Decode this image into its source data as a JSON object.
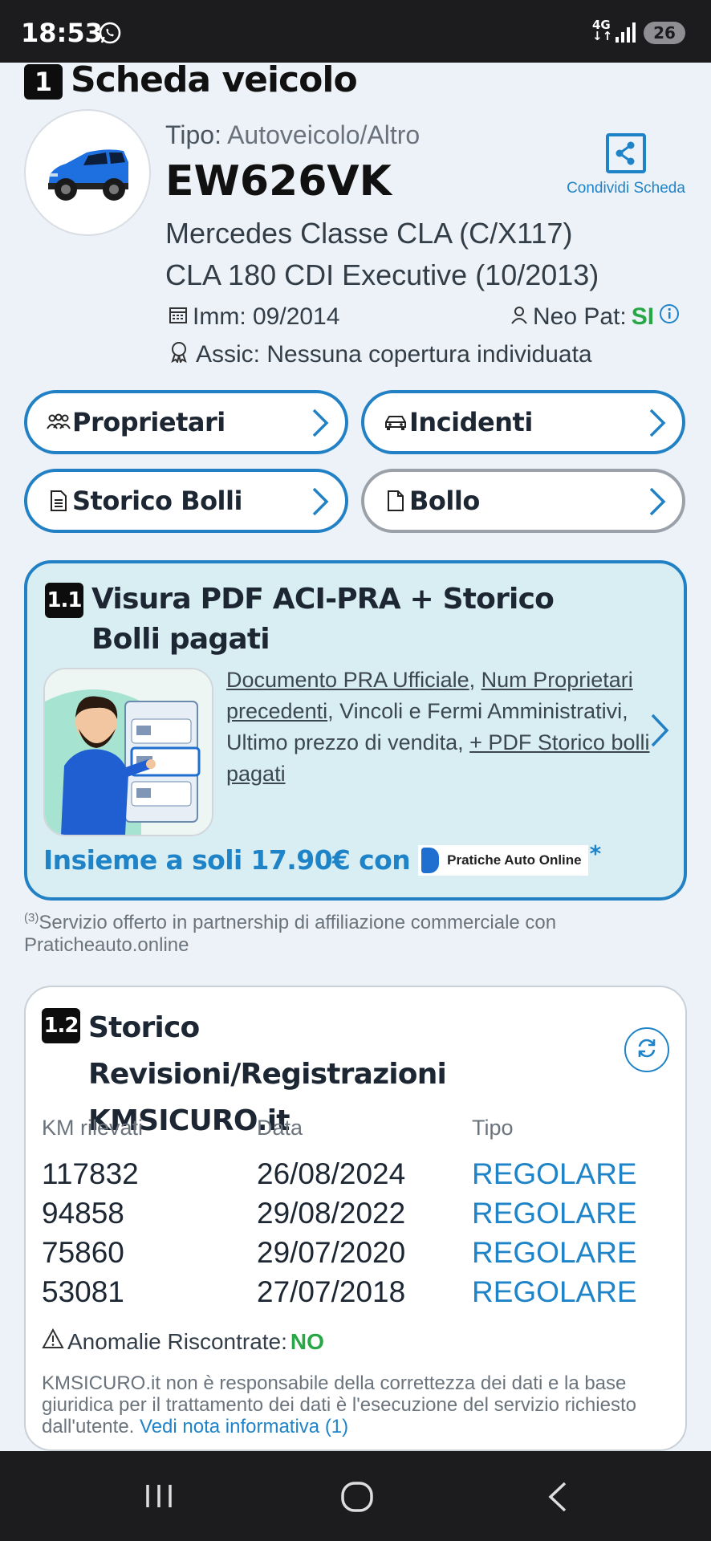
{
  "status_bar": {
    "time": "18:53",
    "network": "4G",
    "battery": "26"
  },
  "vehicle": {
    "section_number": "1",
    "section_title": "Scheda veicolo",
    "tipo_label": "Tipo:",
    "tipo_value": "Autoveicolo/Altro",
    "plate": "EW626VK",
    "share_label": "Condividi Scheda",
    "model_line1": "Mercedes Classe CLA (C/X117)",
    "model_line2": "CLA 180 CDI Executive (10/2013)",
    "imm": "Imm: 09/2014",
    "neo_pat_label": "Neo Pat:",
    "neo_pat_value": "SI",
    "assic": "Assic: Nessuna copertura individuata"
  },
  "buttons": {
    "proprietari": "Proprietari",
    "incidenti": "Incidenti",
    "storico_bolli": "Storico Bolli",
    "bollo": "Bollo"
  },
  "visura": {
    "number": "1.1",
    "title": "Visura PDF ACI-PRA + Storico Bolli pagati",
    "link1": "Documento PRA Ufficiale",
    "link2": "Num Proprietari precedenti",
    "text1": ", Vincoli e Fermi Amministrativi, Ultimo prezzo di vendita, ",
    "link3": "+ PDF Storico bolli pagati",
    "price_text": "Insieme a soli 17.90€ con",
    "partner_logo_text": "Pratiche Auto Online",
    "asterisk": "*"
  },
  "partner_note": {
    "sup": "(3)",
    "text": "Servizio offerto in partnership di affiliazione commerciale con Praticheauto.online"
  },
  "kmsicuro": {
    "number": "1.2",
    "title": "Storico Revisioni/Registrazioni KMSICURO.it",
    "columns": [
      "KM rilevati",
      "Data",
      "Tipo"
    ],
    "rows": [
      {
        "km": "117832",
        "data": "26/08/2024",
        "tipo": "REGOLARE"
      },
      {
        "km": "94858",
        "data": "29/08/2022",
        "tipo": "REGOLARE"
      },
      {
        "km": "75860",
        "data": "29/07/2020",
        "tipo": "REGOLARE"
      },
      {
        "km": "53081",
        "data": "27/07/2018",
        "tipo": "REGOLARE"
      }
    ],
    "anomalie_label": "Anomalie Riscontrate:",
    "anomalie_value": "NO",
    "disclaimer": "KMSICURO.it non è responsabile della correttezza dei dati e la base giuridica per il trattamento dei dati è l'esecuzione del servizio richiesto dall'utente. ",
    "disclaimer_link": "Vedi nota informativa (1)"
  },
  "colors": {
    "accent": "#1f83c8",
    "positive": "#27a745",
    "card_bg": "#d8eef3"
  }
}
